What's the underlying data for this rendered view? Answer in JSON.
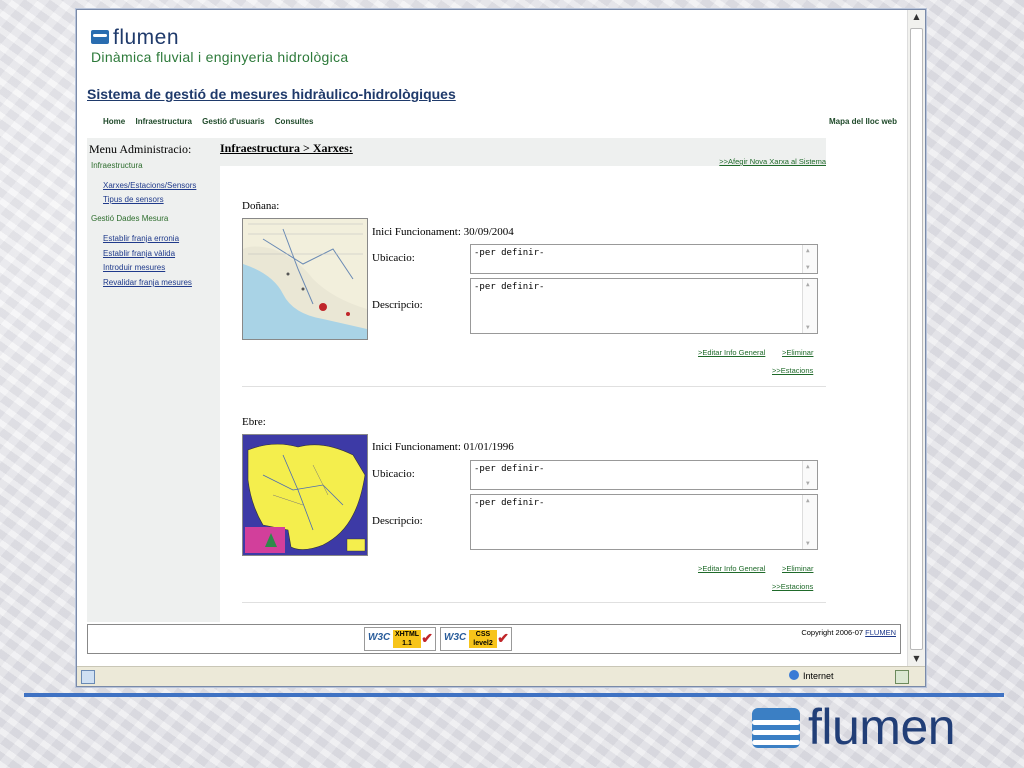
{
  "site": {
    "logo_text": "flumen",
    "tagline": "Dinàmica fluvial i enginyeria hidrològica",
    "title": "Sistema de gestió de mesures hidràulico-hidrològiques"
  },
  "topnav": {
    "items": [
      "Home",
      "Infraestructura",
      "Gestió d'usuaris",
      "Consultes"
    ],
    "sitemap": "Mapa del lloc web"
  },
  "sidebar": {
    "heading": "Menu Administracio:",
    "groups": [
      {
        "label": "Infraestructura",
        "links": [
          "Xarxes/Estacions/Sensors",
          "Tipus de sensors"
        ]
      },
      {
        "label": "Gestió Dades Mesura",
        "links": [
          "Establir franja erronia",
          "Establir franja vàlida",
          "Introduir mesures",
          "Revalidar franja mesures"
        ]
      }
    ]
  },
  "main": {
    "breadcrumb": "Infraestructura > Xarxes:",
    "add_link": ">>Afegir Nova Xarxa al Sistema",
    "networks": [
      {
        "name": "Doñana:",
        "start_label": "Inici Funcionament:",
        "start_date": "30/09/2004",
        "ubicacio_label": "Ubicacio:",
        "ubicacio_value": "-per definir-",
        "descripcio_label": "Descripcio:",
        "descripcio_value": "-per definir-",
        "edit": ">Editar Info General",
        "delete": ">Eliminar",
        "stations": ">>Estacions"
      },
      {
        "name": "Ebre:",
        "start_label": "Inici Funcionament:",
        "start_date": "01/01/1996",
        "ubicacio_label": "Ubicacio:",
        "ubicacio_value": "-per definir-",
        "descripcio_label": "Descripcio:",
        "descripcio_value": "-per definir-",
        "edit": ">Editar Info General",
        "delete": ">Eliminar",
        "stations": ">>Estacions"
      }
    ]
  },
  "footer": {
    "badges": [
      {
        "w3c": "W3C",
        "label": "XHTML 1.1"
      },
      {
        "w3c": "W3C",
        "label": "CSS level2"
      }
    ],
    "copyright": "Copyright 2006-07",
    "copyright_link": "FLUMEN"
  },
  "statusbar": {
    "zone": "Internet"
  },
  "slide": {
    "logo_text": "flumen"
  },
  "colors": {
    "accent_blue": "#3f72c3",
    "link_green": "#1f6a2a",
    "title_navy": "#1f3a6b"
  }
}
